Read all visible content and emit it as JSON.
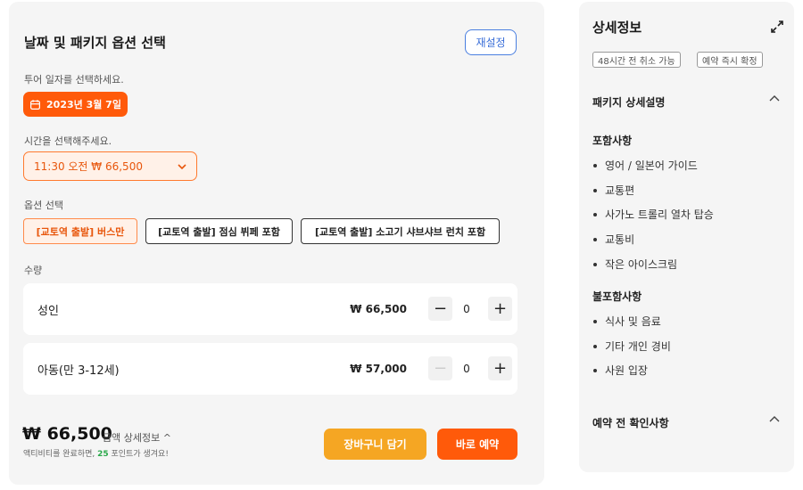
{
  "booking": {
    "title": "날짜 및 패키지 옵션 선택",
    "reset_label": "재설정",
    "date_label": "투어 일자를 선택하세요.",
    "date_value": "2023년 3월 7일",
    "time_label": "시간을 선택해주세요.",
    "time_value": "11:30 오전 ₩ 66,500",
    "option_label": "옵션 선택",
    "options": [
      {
        "label": "[교토역 출발] 버스만",
        "selected": true
      },
      {
        "label": "[교토역 출발] 점심 뷔페 포함",
        "selected": false
      },
      {
        "label": "[교토역 출발] 소고기 샤브샤브 런치 포함",
        "selected": false
      }
    ],
    "quantity_label": "수량",
    "rows": [
      {
        "name": "성인",
        "price": "₩ 66,500",
        "qty": "0"
      },
      {
        "name": "아동(만 3-12세)",
        "price": "₩ 57,000",
        "qty": "0"
      }
    ],
    "total": "₩ 66,500",
    "detail_link": "금액 상세정보 ^",
    "points_prefix": "액티비티를 완료하면, ",
    "points_value": "25",
    "points_suffix": " 포인트가 생겨요!",
    "cart_label": "장바구니 담기",
    "book_label": "바로 예약"
  },
  "details": {
    "title": "상세정보",
    "badges": [
      "48시간 전 취소 가능",
      "예약 즉시 확정"
    ],
    "package_head": "패키지 상세설명",
    "included_head": "포함사항",
    "included": [
      "영어 / 일본어 가이드",
      "교통편",
      "사가노 트롤리 열차 탑승",
      "교통비",
      "작은 아이스크림"
    ],
    "excluded_head": "불포함사항",
    "excluded": [
      "식사 및 음료",
      "기타 개인 경비",
      "사원 입장"
    ],
    "notice_head": "예약 전 확인사항"
  },
  "colors": {
    "accent": "#ff5a0a",
    "cart": "#f5a623",
    "reset": "#3b6fd8",
    "points": "#2aa84a"
  }
}
